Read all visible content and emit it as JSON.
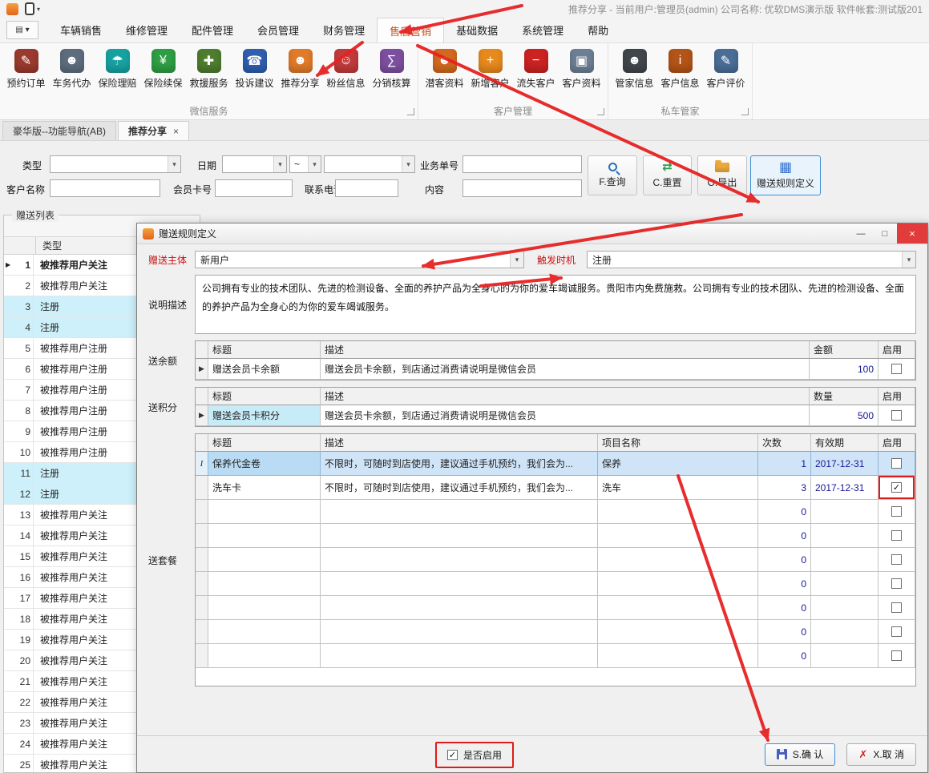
{
  "window": {
    "title": "推荐分享 - 当前用户:管理员(admin) 公司名称: 优软DMS演示版 软件帐套:测试版201"
  },
  "colors": {
    "annotation_red": "#e01b1b",
    "active_menu_orange": "#c7541b",
    "selected_row_blue": "#cfe4f7",
    "value_navy": "#16169a"
  },
  "menu": {
    "launcher_glyph": "▤ ▾",
    "items": [
      "车辆销售",
      "维修管理",
      "配件管理",
      "会员管理",
      "财务管理",
      "售后营销",
      "基础数据",
      "系统管理",
      "帮助"
    ]
  },
  "ribbon": {
    "groups": [
      {
        "label": "微信服务",
        "buttons": [
          {
            "label": "预约订单",
            "icon": "appointment-orders-icon",
            "glyph": "✎"
          },
          {
            "label": "车务代办",
            "icon": "vehicle-agency-icon",
            "glyph": "☻"
          },
          {
            "label": "保险理赔",
            "icon": "insurance-claims-icon",
            "glyph": "☂"
          },
          {
            "label": "保险续保",
            "icon": "insurance-renewal-icon",
            "glyph": "¥"
          },
          {
            "label": "救援服务",
            "icon": "rescue-service-icon",
            "glyph": "✚"
          },
          {
            "label": "投诉建议",
            "icon": "complaints-icon",
            "glyph": "☎"
          },
          {
            "label": "推荐分享",
            "icon": "referral-share-icon",
            "glyph": "☻"
          },
          {
            "label": "粉丝信息",
            "icon": "fans-info-icon",
            "glyph": "☺"
          },
          {
            "label": "分销核算",
            "icon": "distribution-accounting-icon",
            "glyph": "∑"
          }
        ]
      },
      {
        "label": "客户管理",
        "buttons": [
          {
            "label": "潜客资料",
            "icon": "prospect-info-icon",
            "glyph": "☻"
          },
          {
            "label": "新增客户",
            "icon": "add-customer-icon",
            "glyph": "+"
          },
          {
            "label": "流失客户",
            "icon": "lost-customer-icon",
            "glyph": "−"
          },
          {
            "label": "客户资料",
            "icon": "customer-files-icon",
            "glyph": "▣"
          }
        ]
      },
      {
        "label": "私车管家",
        "buttons": [
          {
            "label": "管家信息",
            "icon": "butler-info-icon",
            "glyph": "☻"
          },
          {
            "label": "客户信息",
            "icon": "customer-info-icon",
            "glyph": "i"
          },
          {
            "label": "客户评价",
            "icon": "customer-review-icon",
            "glyph": "✎"
          }
        ]
      }
    ]
  },
  "doc_tabs": {
    "tab1": "豪华版--功能导航(AB)",
    "tab2": "推荐分享",
    "close_glyph": "×"
  },
  "filters": {
    "type_label": "类型",
    "date_label": "日期",
    "range_value": "~",
    "order_label": "业务单号",
    "customer_label": "客户名称",
    "card_label": "会员卡号",
    "phone_label": "联系电话",
    "content_label": "内容"
  },
  "actions": {
    "query": "F.查询",
    "reset": "C.重置",
    "reset_glyph": "⇄",
    "export": "O.导出",
    "rules": "赠送规则定义",
    "rules_glyph": "▦"
  },
  "gift_list": {
    "title": "赠送列表",
    "type_header": "类型",
    "rows": [
      {
        "marker": "▶",
        "num": "1",
        "type": "被推荐用户关注"
      },
      {
        "num": "2",
        "type": "被推荐用户关注"
      },
      {
        "num": "3",
        "type": "注册"
      },
      {
        "num": "4",
        "type": "注册"
      },
      {
        "num": "5",
        "type": "被推荐用户注册"
      },
      {
        "num": "6",
        "type": "被推荐用户注册"
      },
      {
        "num": "7",
        "type": "被推荐用户注册"
      },
      {
        "num": "8",
        "type": "被推荐用户注册"
      },
      {
        "num": "9",
        "type": "被推荐用户注册"
      },
      {
        "num": "10",
        "type": "被推荐用户注册"
      },
      {
        "num": "11",
        "type": "注册"
      },
      {
        "num": "12",
        "type": "注册"
      },
      {
        "num": "13",
        "type": "被推荐用户关注"
      },
      {
        "num": "14",
        "type": "被推荐用户关注"
      },
      {
        "num": "15",
        "type": "被推荐用户关注"
      },
      {
        "num": "16",
        "type": "被推荐用户关注"
      },
      {
        "num": "17",
        "type": "被推荐用户关注"
      },
      {
        "num": "18",
        "type": "被推荐用户关注"
      },
      {
        "num": "19",
        "type": "被推荐用户关注"
      },
      {
        "num": "20",
        "type": "被推荐用户关注"
      },
      {
        "num": "21",
        "type": "被推荐用户关注"
      },
      {
        "num": "22",
        "type": "被推荐用户关注"
      },
      {
        "num": "23",
        "type": "被推荐用户关注"
      },
      {
        "num": "24",
        "type": "被推荐用户关注"
      },
      {
        "num": "25",
        "type": "被推荐用户关注"
      }
    ]
  },
  "dialog": {
    "title": "赠送规则定义",
    "controls": {
      "min": "—",
      "max": "□",
      "close": "×"
    },
    "subject_label": "赠送主体",
    "subject_value": "新用户",
    "trigger_label": "触发时机",
    "trigger_value": "注册",
    "desc_label": "说明描述",
    "desc_value": "公司拥有专业的技术团队、先进的检测设备、全面的养护产品为全身心的为你的爱车竭诚服务。贵阳市内免费施救。公司拥有专业的技术团队、先进的检测设备、全面的养护产品为全身心的为你的爱车竭诚服务。",
    "balance": {
      "label": "送余额",
      "h_title": "标题",
      "h_desc": "描述",
      "h_amount": "金额",
      "h_enable": "启用",
      "row": {
        "marker": "▶",
        "title": "赠送会员卡余额",
        "desc": "赠送会员卡余额，到店通过消费请说明是微信会员",
        "amount": "100",
        "enabled": false
      }
    },
    "points": {
      "label": "送积分",
      "h_title": "标题",
      "h_desc": "描述",
      "h_amount": "数量",
      "h_enable": "启用",
      "row": {
        "marker": "▶",
        "title": "赠送会员卡积分",
        "desc": "赠送会员卡余额，到店通过消费请说明是微信会员",
        "amount": "500",
        "enabled": false
      }
    },
    "packages": {
      "label": "送套餐",
      "h_title": "标题",
      "h_desc": "描述",
      "h_project": "项目名称",
      "h_count": "次数",
      "h_expiry": "有效期",
      "h_enable": "启用",
      "rows": [
        {
          "marker": "I",
          "title": "保养代金卷",
          "desc": "不限时，可随时到店使用，建议通过手机预约，我们会为...",
          "project": "保养",
          "count": "1",
          "expiry": "2017-12-31",
          "enabled": false
        },
        {
          "title": "洗车卡",
          "desc": "不限时，可随时到店使用，建议通过手机预约，我们会为...",
          "project": "洗车",
          "count": "3",
          "expiry": "2017-12-31",
          "enabled": true
        },
        {
          "title": "",
          "desc": "",
          "project": "",
          "count": "0",
          "expiry": "",
          "enabled": false
        },
        {
          "title": "",
          "desc": "",
          "project": "",
          "count": "0",
          "expiry": "",
          "enabled": false
        },
        {
          "title": "",
          "desc": "",
          "project": "",
          "count": "0",
          "expiry": "",
          "enabled": false
        },
        {
          "title": "",
          "desc": "",
          "project": "",
          "count": "0",
          "expiry": "",
          "enabled": false
        },
        {
          "title": "",
          "desc": "",
          "project": "",
          "count": "0",
          "expiry": "",
          "enabled": false
        },
        {
          "title": "",
          "desc": "",
          "project": "",
          "count": "0",
          "expiry": "",
          "enabled": false
        },
        {
          "title": "",
          "desc": "",
          "project": "",
          "count": "0",
          "expiry": "",
          "enabled": false
        }
      ]
    },
    "footer": {
      "enable_label": "是否启用",
      "enabled": true,
      "ok": "S.确 认",
      "cancel": "X.取 消",
      "cancel_glyph": "✗"
    }
  }
}
